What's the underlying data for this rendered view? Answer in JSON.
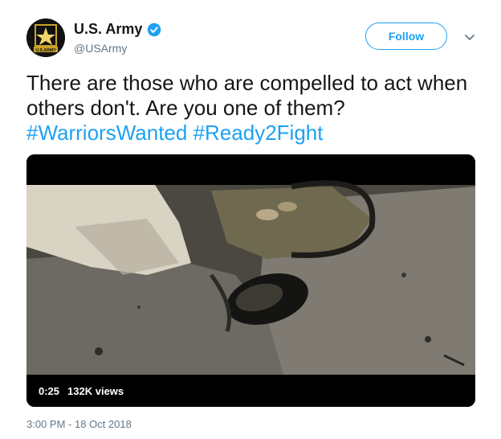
{
  "account": {
    "display_name": "U.S. Army",
    "handle": "@USArmy",
    "avatar_text": "U.S.ARMY",
    "verified": true
  },
  "actions": {
    "follow_label": "Follow",
    "more_icon": "chevron-down-icon"
  },
  "tweet": {
    "text_plain": "There are those who are compelled to act when others don't. Are you one of them?",
    "hashtags": [
      "#WarriorsWanted",
      "#Ready2Fight"
    ],
    "timestamp": "3:00 PM - 18 Oct 2018"
  },
  "media": {
    "type": "video",
    "duration": "0:25",
    "views": "132K views"
  },
  "colors": {
    "accent": "#1da1f2",
    "text": "#14171a",
    "muted": "#657786"
  }
}
